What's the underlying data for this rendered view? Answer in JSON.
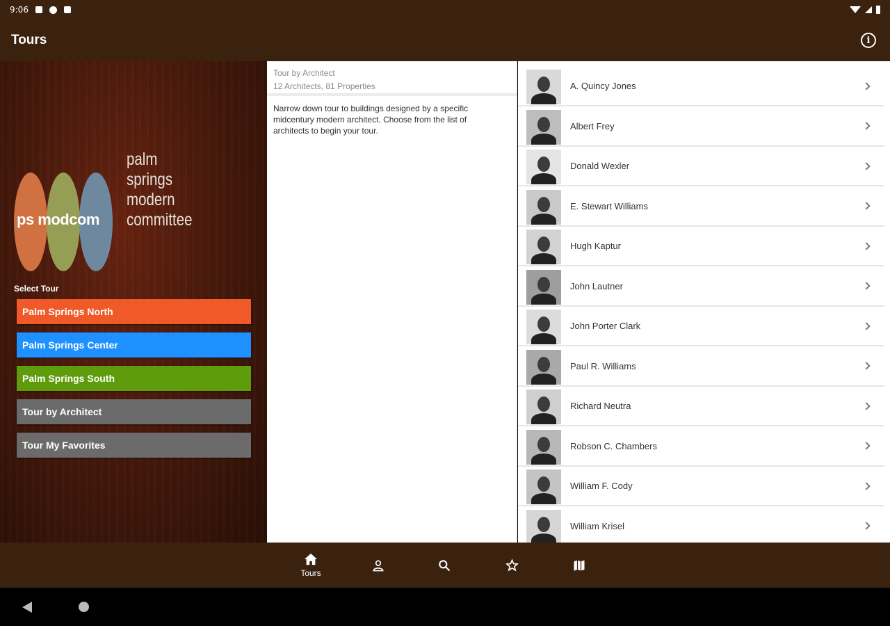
{
  "status_bar": {
    "time": "9:06"
  },
  "app_bar": {
    "title": "Tours",
    "info_glyph": "i"
  },
  "logo": {
    "inner_text": "ps modcom",
    "lines": [
      "palm",
      "springs",
      "modern",
      "committee"
    ],
    "colors": [
      "#d87646",
      "#9aa55a",
      "#6f8ea8"
    ]
  },
  "tour_select": {
    "label": "Select Tour",
    "buttons": [
      {
        "label": "Palm Springs North",
        "color": "#f05a28"
      },
      {
        "label": "Palm Springs Center",
        "color": "#1e90ff"
      },
      {
        "label": "Palm Springs South",
        "color": "#5f9c0c"
      },
      {
        "label": "Tour by Architect",
        "color": "#6b6b6b"
      },
      {
        "label": "Tour My Favorites",
        "color": "#6b6b6b"
      }
    ]
  },
  "detail": {
    "title": "Tour by Architect",
    "subtitle": "12 Architects, 81 Properties",
    "description": "Narrow down tour to buildings designed by a specific midcentury modern architect. Choose from the list of architects to begin your tour."
  },
  "architects": [
    "A. Quincy Jones",
    "Albert Frey",
    "Donald Wexler",
    "E. Stewart Williams",
    "Hugh Kaptur",
    "John Lautner",
    "John Porter Clark",
    "Paul R. Williams",
    "Richard Neutra",
    "Robson C. Chambers",
    "William F. Cody",
    "William Krisel"
  ],
  "bottom_nav": {
    "items": [
      {
        "label": "Tours",
        "icon": "home-icon"
      },
      {
        "label": "",
        "icon": "person-icon"
      },
      {
        "label": "",
        "icon": "search-icon"
      },
      {
        "label": "",
        "icon": "star-icon"
      },
      {
        "label": "",
        "icon": "map-icon"
      }
    ]
  }
}
